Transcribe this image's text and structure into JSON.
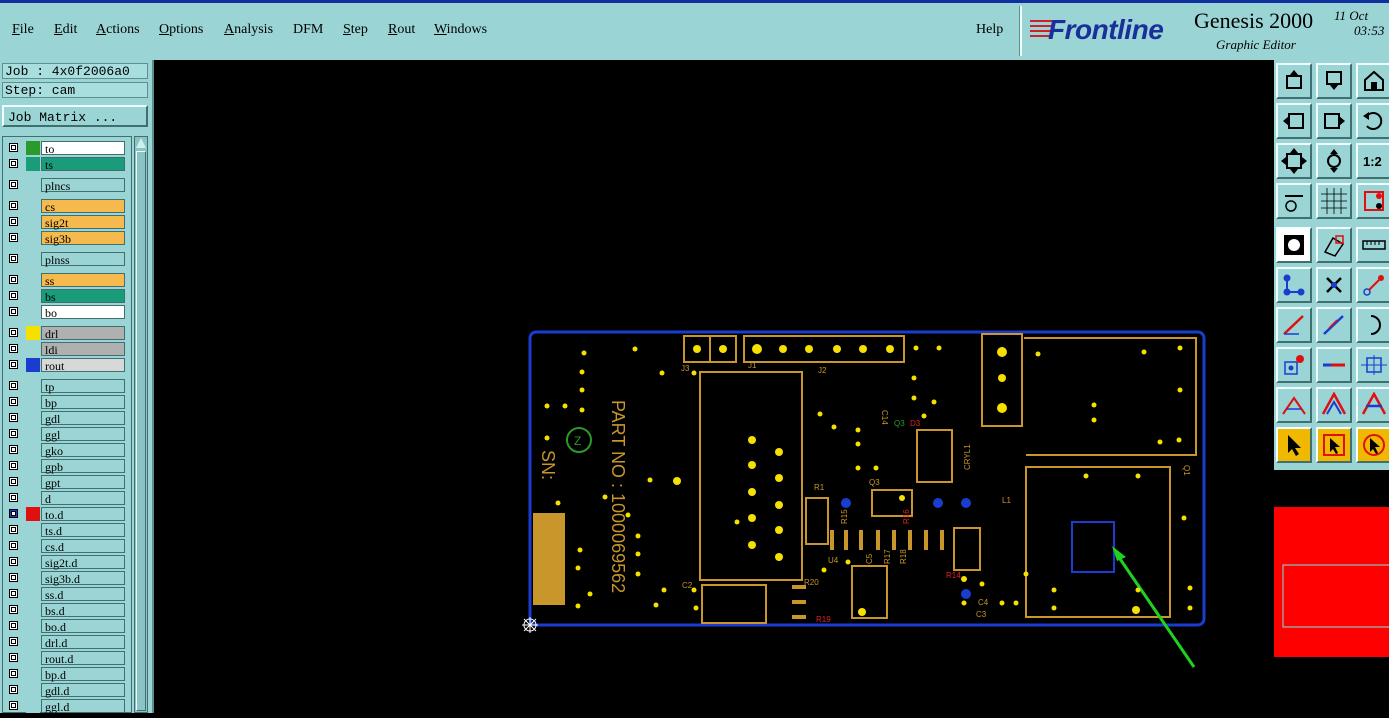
{
  "menu": {
    "items": [
      "File",
      "Edit",
      "Actions",
      "Options",
      "Analysis",
      "DFM",
      "Step",
      "Rout",
      "Windows"
    ],
    "help": "Help"
  },
  "brand": {
    "logo": "Frontline",
    "title": "Genesis 2000",
    "subtitle": "Graphic Editor",
    "date_line1": "11 Oct",
    "date_line2": "03:53"
  },
  "job": {
    "job_label": "Job : 4x0f2006a0",
    "step_label": "Step: cam",
    "matrix_button": "Job Matrix ..."
  },
  "layers": [
    {
      "name": "to",
      "bg": "#ffffff",
      "swatch": "#2a9a2a"
    },
    {
      "name": "ts",
      "bg": "#1a9c7a",
      "swatch": "#1a9c7a"
    },
    {
      "name": "plncs",
      "bg": "#9ad4d4",
      "swatch": "#9ad4d4",
      "gap": true
    },
    {
      "name": "cs",
      "bg": "#f5b94e",
      "swatch": "#9ad4d4",
      "gap": true
    },
    {
      "name": "sig2t",
      "bg": "#f5b94e",
      "swatch": "#9ad4d4"
    },
    {
      "name": "sig3b",
      "bg": "#f5b94e",
      "swatch": "#9ad4d4"
    },
    {
      "name": "plnss",
      "bg": "#9ad4d4",
      "swatch": "#9ad4d4",
      "gap": true
    },
    {
      "name": "ss",
      "bg": "#f5b94e",
      "swatch": "#9ad4d4",
      "gap": true
    },
    {
      "name": "bs",
      "bg": "#1a9c7a",
      "swatch": "#9ad4d4"
    },
    {
      "name": "bo",
      "bg": "#ffffff",
      "swatch": "#9ad4d4"
    },
    {
      "name": "drl",
      "bg": "#b0b0b0",
      "swatch": "#f5e000",
      "gap": true
    },
    {
      "name": "ldi",
      "bg": "#b0b0b0",
      "swatch": "#9ad4d4"
    },
    {
      "name": "rout",
      "bg": "#d8d8d8",
      "swatch": "#1a3ccf"
    },
    {
      "name": "tp",
      "bg": "#9ad4d4",
      "swatch": "#9ad4d4",
      "gap": true
    },
    {
      "name": "bp",
      "bg": "#9ad4d4",
      "swatch": "#9ad4d4"
    },
    {
      "name": "gdl",
      "bg": "#9ad4d4",
      "swatch": "#9ad4d4"
    },
    {
      "name": "ggl",
      "bg": "#9ad4d4",
      "swatch": "#9ad4d4"
    },
    {
      "name": "gko",
      "bg": "#9ad4d4",
      "swatch": "#9ad4d4"
    },
    {
      "name": "gpb",
      "bg": "#9ad4d4",
      "swatch": "#9ad4d4"
    },
    {
      "name": "gpt",
      "bg": "#9ad4d4",
      "swatch": "#9ad4d4"
    },
    {
      "name": "d",
      "bg": "#9ad4d4",
      "swatch": "#9ad4d4"
    },
    {
      "name": "to.d",
      "bg": "#9ad4d4",
      "swatch": "#e01010",
      "work": true
    },
    {
      "name": "ts.d",
      "bg": "#9ad4d4",
      "swatch": "#9ad4d4"
    },
    {
      "name": "cs.d",
      "bg": "#9ad4d4",
      "swatch": "#9ad4d4"
    },
    {
      "name": "sig2t.d",
      "bg": "#9ad4d4",
      "swatch": "#9ad4d4"
    },
    {
      "name": "sig3b.d",
      "bg": "#9ad4d4",
      "swatch": "#9ad4d4"
    },
    {
      "name": "ss.d",
      "bg": "#9ad4d4",
      "swatch": "#9ad4d4"
    },
    {
      "name": "bs.d",
      "bg": "#9ad4d4",
      "swatch": "#9ad4d4"
    },
    {
      "name": "bo.d",
      "bg": "#9ad4d4",
      "swatch": "#9ad4d4"
    },
    {
      "name": "drl.d",
      "bg": "#9ad4d4",
      "swatch": "#9ad4d4"
    },
    {
      "name": "rout.d",
      "bg": "#9ad4d4",
      "swatch": "#9ad4d4"
    },
    {
      "name": "bp.d",
      "bg": "#9ad4d4",
      "swatch": "#9ad4d4"
    },
    {
      "name": "gdl.d",
      "bg": "#9ad4d4",
      "swatch": "#9ad4d4"
    },
    {
      "name": "ggl.d",
      "bg": "#9ad4d4",
      "swatch": "#9ad4d4"
    }
  ],
  "board": {
    "part_no": "PART NO : 1000069562",
    "sn": "SN:",
    "labels": [
      "J3",
      "J1",
      "J2",
      "C14",
      "Q3",
      "D3",
      "CRYL1",
      "Q1",
      "Q3",
      "R15",
      "R16",
      "L1",
      "U4",
      "C5",
      "R17",
      "R18",
      "R1",
      "C2",
      "R20",
      "R19",
      "C4",
      "C3",
      "R14"
    ],
    "outline_color": "#1a3ccf",
    "copper_color": "#c8962a",
    "pad_color": "#f5e000",
    "arrow_color": "#1fd21f"
  },
  "tools": [
    "pan-up-icon",
    "pan-down-icon",
    "home-icon",
    "pan-left-icon",
    "pan-right-icon",
    "undo-view-icon",
    "zoom-fit-icon",
    "zoom-profile-icon",
    "zoom-1to2-icon",
    "measure-icon",
    "grid-icon",
    "snap-icon",
    "select-feature-icon",
    "select-area-icon",
    "ruler-icon",
    "net-icon",
    "delete-icon",
    "connect-icon",
    "line-red-icon",
    "line-blue-icon",
    "arc-icon",
    "pad-icon",
    "dash-icon",
    "rect-icon",
    "triangle-red-icon",
    "triangle-blue-icon",
    "triangle-both-icon",
    "pointer-icon",
    "pointer-box-icon",
    "pointer-circle-icon"
  ]
}
